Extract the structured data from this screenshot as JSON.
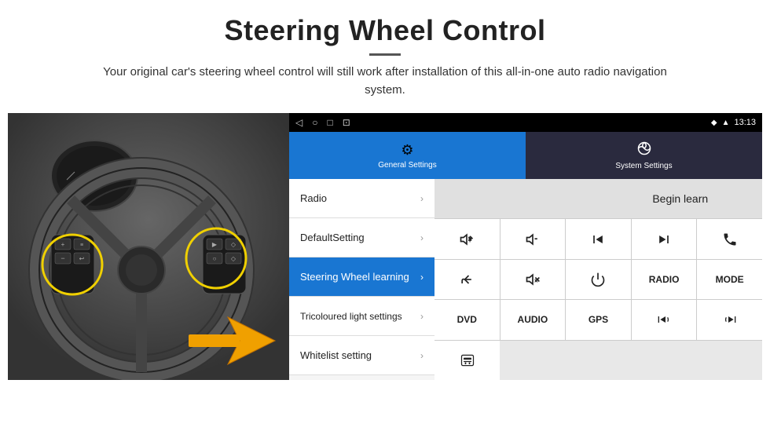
{
  "header": {
    "title": "Steering Wheel Control",
    "subtitle": "Your original car's steering wheel control will still work after installation of this all-in-one auto radio navigation system."
  },
  "status_bar": {
    "nav_icons": [
      "◁",
      "○",
      "□",
      "⊡"
    ],
    "right_icons": [
      "◆",
      "▲"
    ],
    "time": "13:13"
  },
  "tabs": [
    {
      "id": "general",
      "label": "General Settings",
      "icon": "⚙",
      "active": true
    },
    {
      "id": "system",
      "label": "System Settings",
      "icon": "🌐",
      "active": false
    }
  ],
  "menu_items": [
    {
      "id": "radio",
      "label": "Radio",
      "active": false
    },
    {
      "id": "default",
      "label": "DefaultSetting",
      "active": false
    },
    {
      "id": "steering",
      "label": "Steering Wheel learning",
      "active": true
    },
    {
      "id": "tricoloured",
      "label": "Tricoloured light settings",
      "active": false
    },
    {
      "id": "whitelist",
      "label": "Whitelist setting",
      "active": false
    }
  ],
  "controls": {
    "begin_learn": "Begin learn",
    "row2_btns": [
      "vol+",
      "vol-",
      "prev",
      "next",
      "phone"
    ],
    "row3_btns": [
      "back",
      "mute",
      "power",
      "RADIO",
      "MODE"
    ],
    "row4_btns": [
      "DVD",
      "AUDIO",
      "GPS",
      "phone-prev",
      "phone-next"
    ],
    "row5_btns": [
      "usb"
    ]
  }
}
